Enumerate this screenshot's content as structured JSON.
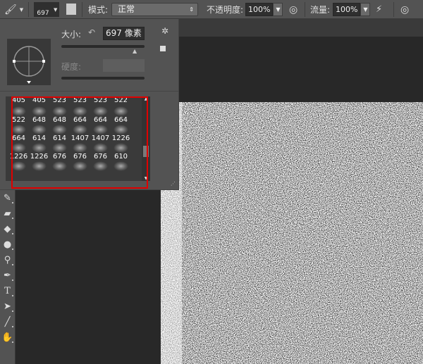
{
  "toolbar": {
    "brush_size": "697",
    "mode_label": "模式:",
    "mode_value": "正常",
    "opacity_label": "不透明度:",
    "opacity_value": "100%",
    "flow_label": "流量:",
    "flow_value": "100%"
  },
  "brush_panel": {
    "size_label": "大小:",
    "size_value": "697 像素",
    "hardness_label": "硬度:",
    "hardness_value": "",
    "size_slider_pct": 95
  },
  "brush_presets": [
    [
      "405",
      "405",
      "523",
      "523",
      "523",
      "522"
    ],
    [
      "522",
      "648",
      "648",
      "664",
      "664",
      "664"
    ],
    [
      "664",
      "614",
      "614",
      "1407",
      "1407",
      "1226"
    ],
    [
      "1226",
      "1226",
      "676",
      "676",
      "676",
      "610"
    ],
    [
      "",
      "",
      "",
      "",
      "",
      ""
    ]
  ],
  "highlight_color": "#e00000"
}
